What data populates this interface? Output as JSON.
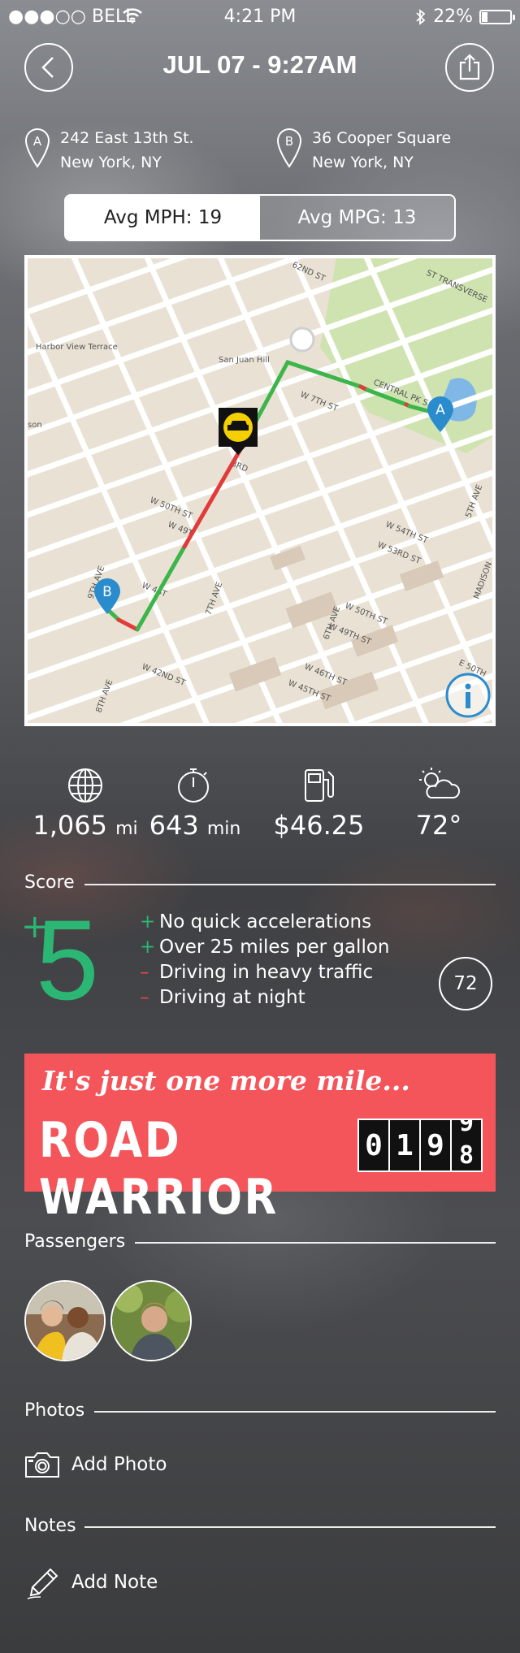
{
  "status_bar": {
    "carrier": "●●●○○ BELL",
    "time": "4:21 PM",
    "battery": "22%",
    "battery_level": 0.22
  },
  "header": {
    "title": "JUL 07 - 9:27AM"
  },
  "route": {
    "start": {
      "marker": "A",
      "line1": "242 East 13th St.",
      "line2": "New York, NY"
    },
    "end": {
      "marker": "B",
      "line1": "36 Cooper Square",
      "line2": "New York, NY"
    }
  },
  "segment": {
    "left": "Avg MPH: 19",
    "right": "Avg MPG: 13",
    "selected": "left"
  },
  "map": {
    "labels": {
      "harbor": "Harbor View Terrace",
      "sanjuan": "San Juan Hill",
      "son": "son",
      "w50": "W 50TH ST",
      "w49": "W 49T",
      "w46": "W 46T",
      "w42": "W 42ND ST",
      "w45": "W 45TH ST",
      "w46e": "W 46TH ST",
      "w49e": "W 49TH ST",
      "w50e": "W 50TH ST",
      "w53": "W 53RD ST",
      "w54": "W 54TH ST",
      "w7th": "W 7TH ST",
      "central": "CENTRAL PK S",
      "ave7": "7TH AVE",
      "ave6": "6TH AVE",
      "ave5": "5TH AVE",
      "ave8": "8TH AVE",
      "ave9": "9TH AVE",
      "madison": "MADISON",
      "transverse": "ST TRANSVERSE",
      "nd": "62ND ST",
      "e50": "E 50TH",
      "w3rd": "3RD"
    },
    "marker_a": "A",
    "marker_b": "B",
    "colors": {
      "good": "#3cb54a",
      "bad": "#e23b3b"
    }
  },
  "stats": [
    {
      "icon": "globe-icon",
      "value": "1,065",
      "unit": "mi"
    },
    {
      "icon": "stopwatch-icon",
      "value": "643",
      "unit": "min"
    },
    {
      "icon": "fuel-pump-icon",
      "value": "$46.25",
      "unit": ""
    },
    {
      "icon": "partly-cloudy-icon",
      "value": "72°",
      "unit": ""
    }
  ],
  "score": {
    "label": "Score",
    "value": "5",
    "sign": "+",
    "reasons": [
      {
        "sign": "+",
        "text": "No quick accelerations",
        "positive": true
      },
      {
        "sign": "+",
        "text": "Over 25 miles per gallon",
        "positive": true
      },
      {
        "sign": "–",
        "text": "Driving in heavy traffic",
        "positive": false
      },
      {
        "sign": "–",
        "text": "Driving at night",
        "positive": false
      }
    ],
    "total": "72"
  },
  "banner": {
    "tagline": "It's just one more mile...",
    "title": "ROAD WARRIOR",
    "digits": [
      "0",
      "1",
      "9"
    ],
    "rolling_top": "9",
    "rolling_bottom": "8",
    "color": "#f4555a"
  },
  "passengers": {
    "label": "Passengers"
  },
  "photos": {
    "label": "Photos",
    "action": "Add Photo"
  },
  "notes": {
    "label": "Notes",
    "action": "Add Note"
  }
}
